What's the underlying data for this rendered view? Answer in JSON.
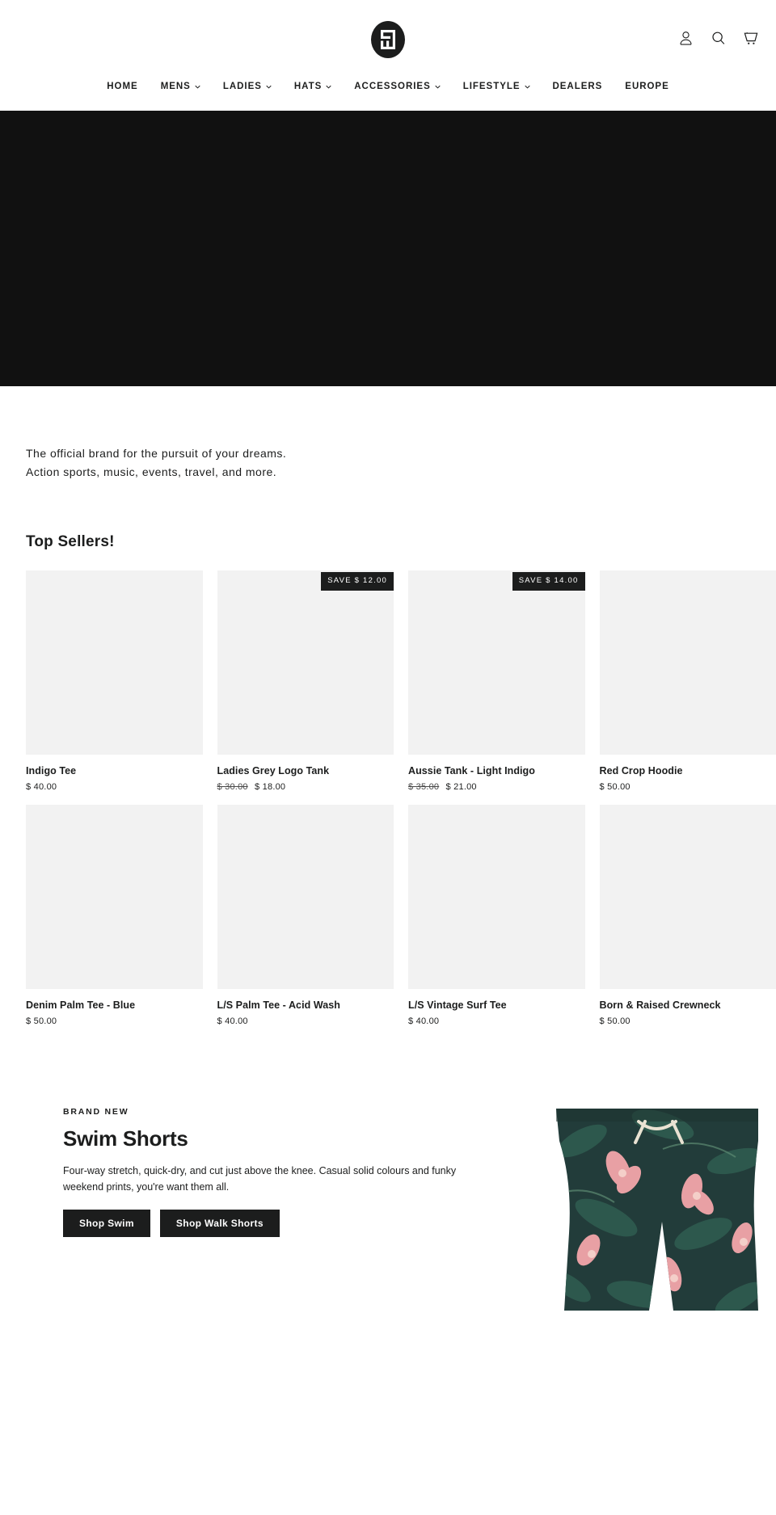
{
  "header": {
    "logo_name": "brand-logo",
    "icons": [
      {
        "name": "account-icon",
        "label": "Log in"
      },
      {
        "name": "search-icon",
        "label": "Search"
      },
      {
        "name": "cart-icon",
        "label": "Cart"
      }
    ],
    "nav": [
      {
        "label": "HOME",
        "has_caret": false
      },
      {
        "label": "MENS",
        "has_caret": true
      },
      {
        "label": "LADIES",
        "has_caret": true
      },
      {
        "label": "HATS",
        "has_caret": true
      },
      {
        "label": "ACCESSORIES",
        "has_caret": true
      },
      {
        "label": "LIFESTYLE",
        "has_caret": true
      },
      {
        "label": "DEALERS",
        "has_caret": false
      },
      {
        "label": "EUROPE",
        "has_caret": false
      }
    ]
  },
  "hero": {
    "background_color": "#111111"
  },
  "tagline": {
    "line1": "The official brand for the pursuit of your dreams.",
    "line2": "Action sports, music, events, travel, and more."
  },
  "top_sellers": {
    "title": "Top Sellers!",
    "products": [
      {
        "name": "Indigo Tee",
        "price": "$ 40.00",
        "old_price": "",
        "badge": ""
      },
      {
        "name": "Ladies Grey Logo Tank",
        "price": "$ 18.00",
        "old_price": "$ 30.00",
        "badge": "SAVE $ 12.00"
      },
      {
        "name": "Aussie Tank - Light Indigo",
        "price": "$ 21.00",
        "old_price": "$ 35.00",
        "badge": "SAVE $ 14.00"
      },
      {
        "name": "Red Crop Hoodie",
        "price": "$ 50.00",
        "old_price": "",
        "badge": ""
      },
      {
        "name": "Denim Palm Tee - Blue",
        "price": "$ 50.00",
        "old_price": "",
        "badge": ""
      },
      {
        "name": "L/S Palm Tee - Acid Wash",
        "price": "$ 40.00",
        "old_price": "",
        "badge": ""
      },
      {
        "name": "L/S Vintage Surf Tee",
        "price": "$ 40.00",
        "old_price": "",
        "badge": ""
      },
      {
        "name": "Born & Raised Crewneck",
        "price": "$ 50.00",
        "old_price": "",
        "badge": ""
      }
    ]
  },
  "promo": {
    "eyebrow": "BRAND NEW",
    "heading": "Swim Shorts",
    "body": "Four-way stretch, quick-dry, and cut just above the knee. Casual solid colours and funky weekend prints, you're want them all.",
    "button_primary": "Shop Swim",
    "button_secondary": "Shop Walk Shorts",
    "image_name": "swim-shorts-photo"
  },
  "colors": {
    "text": "#1c1d1d",
    "hero_bg": "#111111",
    "placeholder": "#f2f2f2",
    "badge_bg": "#1c1d1d"
  }
}
